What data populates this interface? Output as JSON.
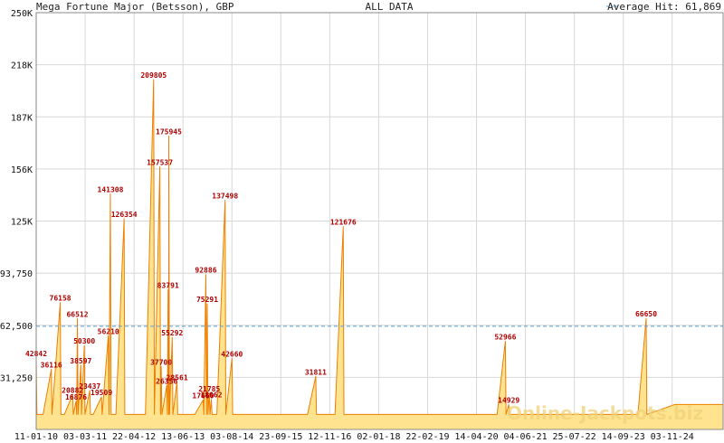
{
  "header": {
    "title": "Mega Fortune Major (Betsson), GBP",
    "center": "ALL DATA",
    "legend": "Average Hit: 61,869"
  },
  "watermark": "Online-Jackpots.biz",
  "colors": {
    "fill": "#ffe38f",
    "line": "#ee7f00",
    "avg": "#5a9fd4",
    "label": "#b00000",
    "grid": "#d8d8d8"
  },
  "chart_data": {
    "type": "area",
    "ylim": [
      0,
      250000
    ],
    "y_ticks": [
      {
        "v": 31250,
        "t": "31,250"
      },
      {
        "v": 62500,
        "t": "62,500"
      },
      {
        "v": 93750,
        "t": "93,750"
      },
      {
        "v": 125000,
        "t": "125K"
      },
      {
        "v": 156250,
        "t": "156K"
      },
      {
        "v": 187500,
        "t": "187K"
      },
      {
        "v": 218750,
        "t": "218K"
      },
      {
        "v": 250000,
        "t": "250K"
      }
    ],
    "x_ticks": [
      "11-01-10",
      "03-03-11",
      "22-04-12",
      "13-06-13",
      "03-08-14",
      "23-09-15",
      "12-11-16",
      "02-01-18",
      "22-02-19",
      "14-04-20",
      "04-06-21",
      "25-07-22",
      "14-09-23",
      "03-11-24"
    ],
    "average": 61869,
    "peaks": [
      {
        "t": 0.0,
        "v": 42842
      },
      {
        "t": 0.035,
        "v": 76158
      },
      {
        "t": 0.022,
        "v": 36116
      },
      {
        "t": 0.06,
        "v": 66512
      },
      {
        "t": 0.065,
        "v": 38597
      },
      {
        "t": 0.07,
        "v": 50300
      },
      {
        "t": 0.053,
        "v": 20882
      },
      {
        "t": 0.058,
        "v": 16876
      },
      {
        "t": 0.078,
        "v": 23437
      },
      {
        "t": 0.095,
        "v": 19509
      },
      {
        "t": 0.105,
        "v": 56210
      },
      {
        "t": 0.108,
        "v": 141308
      },
      {
        "t": 0.128,
        "v": 126354
      },
      {
        "t": 0.171,
        "v": 209805
      },
      {
        "t": 0.18,
        "v": 157537
      },
      {
        "t": 0.182,
        "v": 37700
      },
      {
        "t": 0.193,
        "v": 175945
      },
      {
        "t": 0.192,
        "v": 83791
      },
      {
        "t": 0.198,
        "v": 55292
      },
      {
        "t": 0.19,
        "v": 26356
      },
      {
        "t": 0.205,
        "v": 28561
      },
      {
        "t": 0.247,
        "v": 92886
      },
      {
        "t": 0.249,
        "v": 75291
      },
      {
        "t": 0.243,
        "v": 17660
      },
      {
        "t": 0.252,
        "v": 21785
      },
      {
        "t": 0.255,
        "v": 18062
      },
      {
        "t": 0.275,
        "v": 137498
      },
      {
        "t": 0.285,
        "v": 42660
      },
      {
        "t": 0.407,
        "v": 31811
      },
      {
        "t": 0.447,
        "v": 121676
      },
      {
        "t": 0.683,
        "v": 52966
      },
      {
        "t": 0.688,
        "v": 14929
      },
      {
        "t": 0.888,
        "v": 66650
      }
    ]
  }
}
